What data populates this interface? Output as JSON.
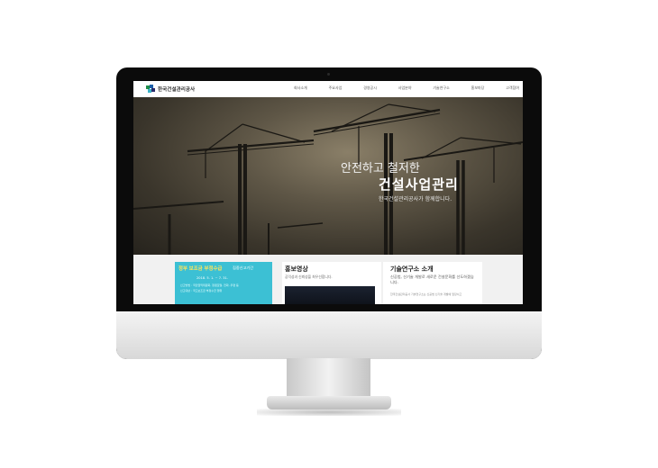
{
  "nav": {
    "logo_text": "한국건설관리공사",
    "items": [
      "회사소개",
      "주요사업",
      "경영공시",
      "사업분야",
      "기술연구소",
      "홍보마당",
      "고객참여"
    ]
  },
  "hero": {
    "line1": "안전하고 철저한",
    "line2": "건설사업관리",
    "line3": "한국건설관리공사가 함께합니다."
  },
  "banner": {
    "title": "정부 보조금 부정수급",
    "subtitle": "집중신고기간",
    "date": "2018. 5. 1. ~ 7. 31.",
    "lines": [
      "신고방법 : 국민권익위원회, 청렴포털, 전화, 우편 등",
      "신고대상 : 국고보조금 부정수급 행위"
    ]
  },
  "promo": {
    "title": "홍보영상",
    "desc": "공익성과 신뢰성을 최우선합니다."
  },
  "research": {
    "title": "기술연구소 소개",
    "desc": "신공법, 신기술 개발로 새로운 건설문화를 선도하겠습니다.",
    "small": "한국건설관리공사 기술연구소는 신공법 신기술 개발에 앞장서고"
  },
  "colors": {
    "hero_sky": "#5e5646",
    "banner_bg": "#3cc0d4",
    "banner_title": "#ffe45c"
  }
}
